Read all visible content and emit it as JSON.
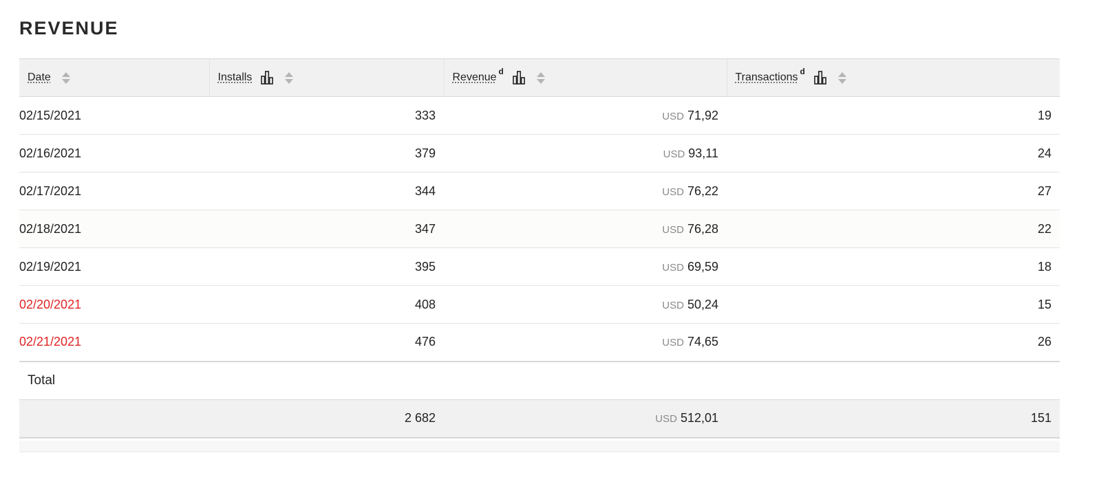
{
  "page": {
    "title": "REVENUE"
  },
  "table": {
    "columns": [
      {
        "label": "Date",
        "superscript": "",
        "chart_icon": false
      },
      {
        "label": "Installs",
        "superscript": "",
        "chart_icon": true
      },
      {
        "label": "Revenue",
        "superscript": "d",
        "chart_icon": true
      },
      {
        "label": "Transactions",
        "superscript": "d",
        "chart_icon": true
      }
    ],
    "currency": "USD",
    "rows": [
      {
        "date": "02/15/2021",
        "installs": "333",
        "revenue": "71,92",
        "transactions": "19",
        "weekend": false
      },
      {
        "date": "02/16/2021",
        "installs": "379",
        "revenue": "93,11",
        "transactions": "24",
        "weekend": false
      },
      {
        "date": "02/17/2021",
        "installs": "344",
        "revenue": "76,22",
        "transactions": "27",
        "weekend": false
      },
      {
        "date": "02/18/2021",
        "installs": "347",
        "revenue": "76,28",
        "transactions": "22",
        "weekend": false
      },
      {
        "date": "02/19/2021",
        "installs": "395",
        "revenue": "69,59",
        "transactions": "18",
        "weekend": false
      },
      {
        "date": "02/20/2021",
        "installs": "408",
        "revenue": "50,24",
        "transactions": "15",
        "weekend": true
      },
      {
        "date": "02/21/2021",
        "installs": "476",
        "revenue": "74,65",
        "transactions": "26",
        "weekend": true
      }
    ],
    "total": {
      "label": "Total",
      "installs": "2 682",
      "revenue": "512,01",
      "transactions": "151"
    }
  },
  "colors": {
    "weekend_date": "#e02424",
    "header_bg": "#f1f1f1",
    "currency_text": "#8a8a8a"
  },
  "icons": {
    "chart": "bar-chart-icon",
    "sort": "sort-icon"
  }
}
